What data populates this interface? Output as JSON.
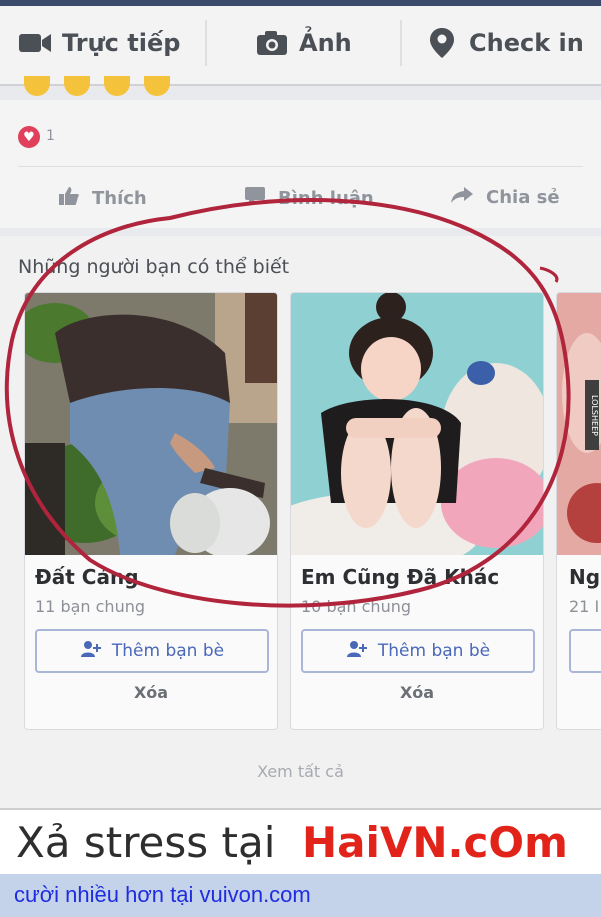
{
  "composer": {
    "live_label": "Trực tiếp",
    "photo_label": "Ảnh",
    "checkin_label": "Check in"
  },
  "post": {
    "reaction_count": "1",
    "like_label": "Thích",
    "comment_label": "Bình luận",
    "share_label": "Chia sẻ"
  },
  "pymk": {
    "title": "Những người bạn có thể biết",
    "cards": [
      {
        "name": "Đất Cảng",
        "mutual": "11 bạn chung",
        "add_label": "Thêm bạn bè",
        "remove_label": "Xóa"
      },
      {
        "name": "Em Cũng Đã Khác",
        "mutual": "10 bạn chung",
        "add_label": "Thêm bạn bè",
        "remove_label": "Xóa"
      },
      {
        "name": "Ng",
        "mutual": "21 I"
      }
    ],
    "see_all": "Xem tất cả"
  },
  "side_watermark": "LOLSHEEP",
  "banner": {
    "left": "Xả stress tại",
    "right": "HaiVN.cOm"
  },
  "footer": {
    "prefix": "cười nhiều hơn tại",
    "site": "vuivon.com"
  },
  "colors": {
    "accent_blue": "#4a68b8",
    "circle_red": "#b0243c",
    "banner_red": "#e2231a",
    "footer_link": "#1f2de0"
  }
}
